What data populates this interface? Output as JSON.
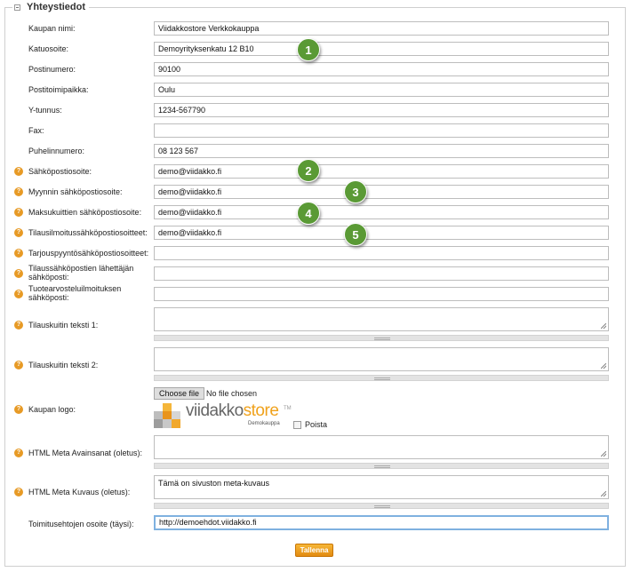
{
  "section": {
    "title": "Yhteystiedot"
  },
  "fields": [
    {
      "label": "Kaupan nimi:",
      "value": "Viidakkostore Verkkokauppa",
      "help": false
    },
    {
      "label": "Katuosoite:",
      "value": "Demoyrityksenkatu 12 B10",
      "help": false
    },
    {
      "label": "Postinumero:",
      "value": "90100",
      "help": false
    },
    {
      "label": "Postitoimipaikka:",
      "value": "Oulu",
      "help": false
    },
    {
      "label": "Y-tunnus:",
      "value": "1234-567790",
      "help": false
    },
    {
      "label": "Fax:",
      "value": "",
      "help": false
    },
    {
      "label": "Puhelinnumero:",
      "value": "08 123 567",
      "help": false
    },
    {
      "label": "Sähköpostiosoite:",
      "value": "demo@viidakko.fi",
      "help": true
    },
    {
      "label": "Myynnin sähköpostiosoite:",
      "value": "demo@viidakko.fi",
      "help": true
    },
    {
      "label": "Maksukuittien sähköpostiosoite:",
      "value": "demo@viidakko.fi",
      "help": true
    },
    {
      "label": "Tilausilmoitussähköpostiosoitteet:",
      "value": "demo@viidakko.fi",
      "help": true
    },
    {
      "label": "Tarjouspyyntösähköpostiosoitteet:",
      "value": "",
      "help": true
    },
    {
      "label": "Tilaussähköpostien lähettäjän sähköposti:",
      "value": "",
      "help": true
    },
    {
      "label": "Tuotearvosteluilmoituksen sähköposti:",
      "value": "",
      "help": true
    }
  ],
  "textareas": {
    "receipt1": {
      "label": "Tilauskuitin teksti 1:",
      "value": ""
    },
    "receipt2": {
      "label": "Tilauskuitin teksti 2:",
      "value": ""
    },
    "meta_keywords": {
      "label": "HTML Meta Avainsanat (oletus):",
      "value": ""
    },
    "meta_description": {
      "label": "HTML Meta Kuvaus (oletus):",
      "value": "Tämä on sivuston meta-kuvaus"
    }
  },
  "logo_field": {
    "label": "Kaupan logo:",
    "choose_label": "Choose file",
    "file_status": "No file chosen",
    "logo_text_main": "viidakko",
    "logo_text_accent": "store",
    "logo_tm": "TM",
    "logo_subtitle": "Demokauppa",
    "delete_label": "Poista"
  },
  "terms": {
    "label": "Toimitusehtojen osoite (täysi):",
    "value": "http://demoehdot.viidakko.fi"
  },
  "help_glyph": "?",
  "save_label": "Tallenna",
  "badges": [
    "1",
    "2",
    "3",
    "4",
    "5"
  ],
  "colors": {
    "help": "#e79a25",
    "badge": "#5a9a35",
    "save": "#f0a21c"
  }
}
